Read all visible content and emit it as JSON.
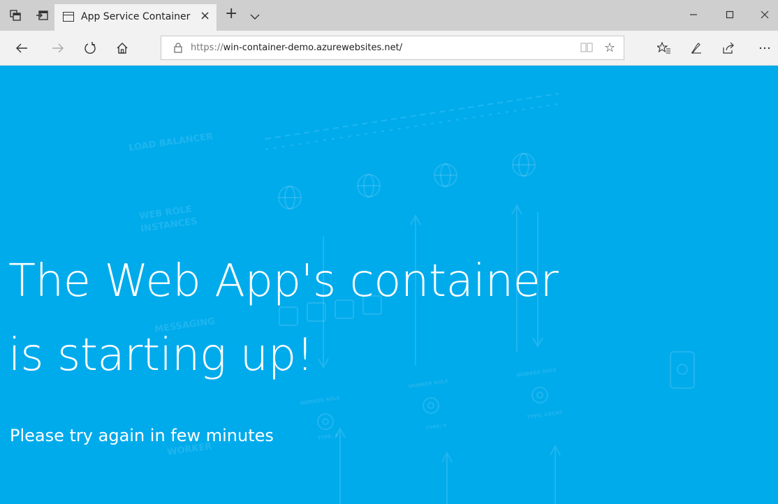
{
  "browser": {
    "tab": {
      "title": "App Service Container"
    },
    "address": {
      "scheme": "https://",
      "host": "win-container-demo.azurewebsites.net/"
    }
  },
  "page": {
    "headline_line1": "The Web App's container",
    "headline_line2": "is starting up!",
    "subtitle": "Please try again in few minutes",
    "background_color": "#00abec"
  },
  "background_diagram": {
    "labels": [
      "LOAD BALANCER",
      "WEB ROLE",
      "INSTANCES",
      "MESSAGING",
      "WORKER ROLE",
      "WORKER ROLE",
      "WORKER ROLE",
      "TYPE: X",
      "TYPE: Y",
      "TYPE: CACHE",
      "WORKER"
    ]
  }
}
